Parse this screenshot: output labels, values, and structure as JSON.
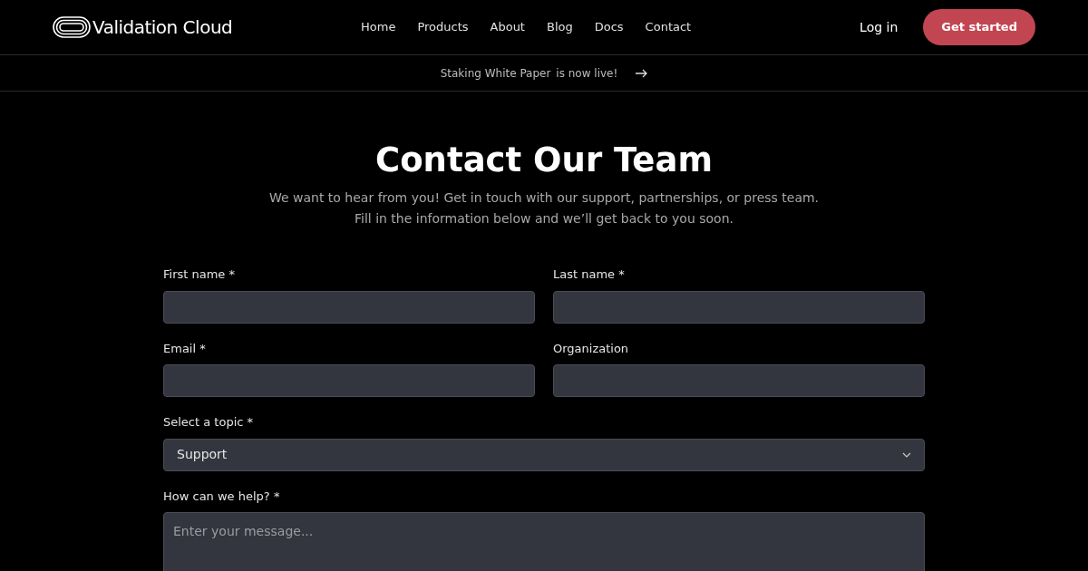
{
  "header": {
    "logo_text": "Validation Cloud",
    "nav": [
      {
        "label": "Home"
      },
      {
        "label": "Products"
      },
      {
        "label": "About"
      },
      {
        "label": "Blog"
      },
      {
        "label": "Docs"
      },
      {
        "label": "Contact"
      }
    ],
    "login": "Log in",
    "cta": "Get started"
  },
  "banner": {
    "link": "Staking White Paper",
    "text": "is now live!"
  },
  "title": "Contact Our Team",
  "subtitle": [
    "We want to hear from you! Get in touch with our support, partnerships, or press team.",
    "Fill in the information below and we’ll get back to you soon."
  ],
  "form": {
    "fields": [
      {
        "kind": "input",
        "label": "First name *"
      },
      {
        "kind": "input",
        "label": "Last name *"
      },
      {
        "kind": "input",
        "label": "Email *"
      },
      {
        "kind": "input",
        "label": "Organization"
      },
      {
        "kind": "select",
        "label": "Select a topic *",
        "value": "Support"
      },
      {
        "kind": "textarea",
        "label": "How can we help? *",
        "placeholder": "Enter your message..."
      }
    ]
  }
}
